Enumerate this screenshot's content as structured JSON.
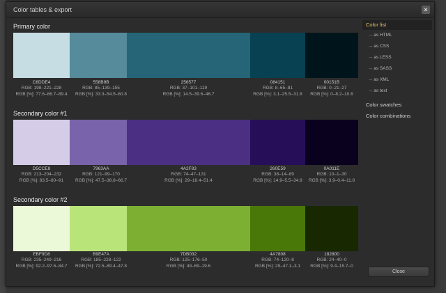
{
  "dialog": {
    "title": "Color tables & export",
    "close_icon": "×"
  },
  "sections": [
    {
      "title": "Primary color",
      "swatches": [
        {
          "hex": "C6DDE4",
          "color": "#C6DDE4",
          "rgb": "RGB: 198–221–228",
          "pct": "RGB [%]: 77.6–86.7–89.4"
        },
        {
          "hex": "558B9B",
          "color": "#558B9B",
          "rgb": "RGB: 85–139–155",
          "pct": "RGB [%]: 33.3–54.5–60.8"
        },
        {
          "hex": "256577",
          "color": "#256577",
          "rgb": "RGB: 37–101–119",
          "pct": "RGB [%]: 14.5–39.6–46.7"
        },
        {
          "hex": "084151",
          "color": "#084151",
          "rgb": "RGB: 8–65–81",
          "pct": "RGB [%]: 3.1–25.5–31.8"
        },
        {
          "hex": "00151B",
          "color": "#00151B",
          "rgb": "RGB: 0–21–27",
          "pct": "RGB [%]: 0–8.2–10.6"
        }
      ]
    },
    {
      "title": "Secondary color #1",
      "swatches": [
        {
          "hex": "D5CCE8",
          "color": "#D5CCE8",
          "rgb": "RGB: 213–204–232",
          "pct": "RGB [%]: 83.5–80–91"
        },
        {
          "hex": "7963AA",
          "color": "#7963AA",
          "rgb": "RGB: 121–99–170",
          "pct": "RGB [%]: 47.5–38.8–66.7"
        },
        {
          "hex": "4A2F83",
          "color": "#4A2F83",
          "rgb": "RGB: 74–47–131",
          "pct": "RGB [%]: 29–18.4–51.4"
        },
        {
          "hex": "260E59",
          "color": "#260E59",
          "rgb": "RGB: 38–14–89",
          "pct": "RGB [%]: 14.9–5.5–34.9"
        },
        {
          "hex": "0A011E",
          "color": "#0A011E",
          "rgb": "RGB: 10–1–30",
          "pct": "RGB [%]: 3.9–0.4–11.8"
        }
      ]
    },
    {
      "title": "Secondary color #2",
      "swatches": [
        {
          "hex": "EBF9D8",
          "color": "#EBF9D8",
          "rgb": "RGB: 235–249–216",
          "pct": "RGB [%]: 92.2–97.6–84.7"
        },
        {
          "hex": "B9E47A",
          "color": "#B9E47A",
          "rgb": "RGB: 185–228–122",
          "pct": "RGB [%]: 72.5–89.4–47.8"
        },
        {
          "hex": "7DB032",
          "color": "#7DB032",
          "rgb": "RGB: 125–176–50",
          "pct": "RGB [%]: 49–69–19.6"
        },
        {
          "hex": "4A7808",
          "color": "#4A7808",
          "rgb": "RGB: 74–120–8",
          "pct": "RGB [%]: 29–47.1–3.1"
        },
        {
          "hex": "182800",
          "color": "#182800",
          "rgb": "RGB: 24–40–0",
          "pct": "RGB [%]: 9.4–15.7–0"
        }
      ]
    }
  ],
  "sidebar": {
    "items": [
      {
        "label": "Color list",
        "active": true
      },
      {
        "label": "→ as HTML"
      },
      {
        "label": "→ as CSS"
      },
      {
        "label": "→ as LESS"
      },
      {
        "label": "→ as SASS"
      },
      {
        "label": "→ as XML"
      },
      {
        "label": "→ as text"
      },
      {
        "label": "Color swatches"
      },
      {
        "label": "Color combinations"
      }
    ]
  },
  "footer": {
    "close_label": "Close"
  }
}
